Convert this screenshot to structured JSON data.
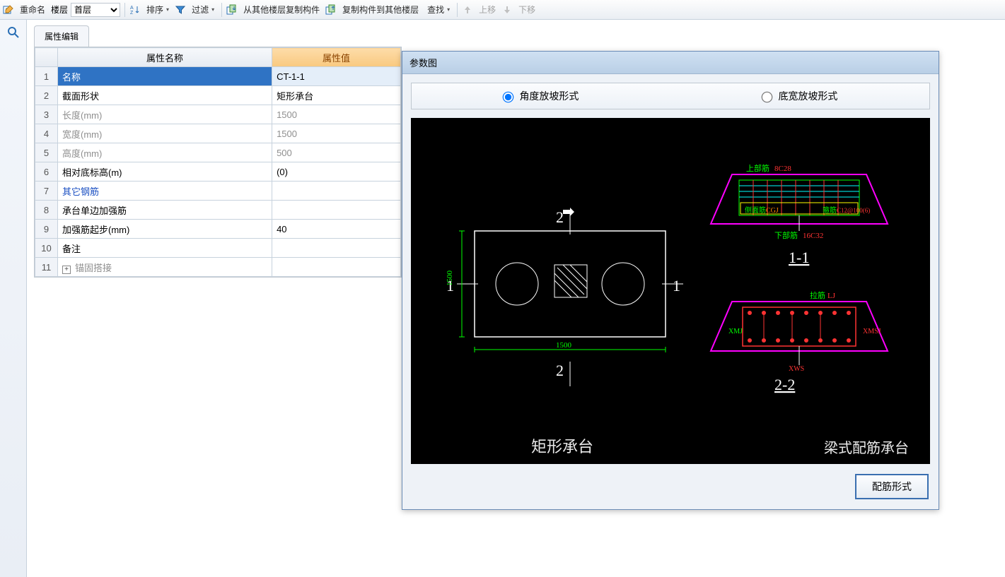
{
  "toolbar": {
    "rename": "重命名",
    "floor_label": "楼层",
    "floor_value": "首层",
    "sort": "排序",
    "filter": "过滤",
    "copy_from": "从其他楼层复制构件",
    "copy_to": "复制构件到其他楼层",
    "find": "查找",
    "move_up": "上移",
    "move_down": "下移"
  },
  "panel": {
    "title": "属性编辑"
  },
  "grid": {
    "col_name": "属性名称",
    "col_value": "属性值",
    "rows": [
      {
        "n": "1",
        "name": "名称",
        "value": "CT-1-1",
        "sel": true
      },
      {
        "n": "2",
        "name": "截面形状",
        "value": "矩形承台"
      },
      {
        "n": "3",
        "name": "长度(mm)",
        "value": "1500",
        "dim": true
      },
      {
        "n": "4",
        "name": "宽度(mm)",
        "value": "1500",
        "dim": true
      },
      {
        "n": "5",
        "name": "高度(mm)",
        "value": "500",
        "dim": true
      },
      {
        "n": "6",
        "name": "相对底标高(m)",
        "value": "(0)"
      },
      {
        "n": "7",
        "name": "其它钢筋",
        "value": "",
        "link": true
      },
      {
        "n": "8",
        "name": "承台单边加强筋",
        "value": ""
      },
      {
        "n": "9",
        "name": "加强筋起步(mm)",
        "value": "40"
      },
      {
        "n": "10",
        "name": "备注",
        "value": ""
      },
      {
        "n": "11",
        "name": "锚固搭接",
        "value": "",
        "expand": true,
        "dim": true
      }
    ]
  },
  "param": {
    "title": "参数图",
    "opt_angle": "角度放坡形式",
    "opt_width": "底宽放坡形式",
    "plan_caption": "矩形承台",
    "beam_caption": "梁式配筋承台",
    "sec11": "1-1",
    "sec22": "2-2",
    "dim_len": "1500",
    "dim_wid": "1500",
    "top_rebar": "上部筋",
    "top_rebar_val": "8C28",
    "side_rebar": "侧面筋",
    "side_rebar_val": "CGJ",
    "stirrup": "箍筋",
    "stirrup_val": "C12@100(6)",
    "bottom_rebar": "下部筋",
    "bottom_rebar_val": "16C32",
    "lj": "拉筋",
    "lj_val": "LJ",
    "xmj1": "XMJ",
    "xmj2": "XMSJ",
    "xws": "XWS",
    "button": "配筋形式"
  }
}
